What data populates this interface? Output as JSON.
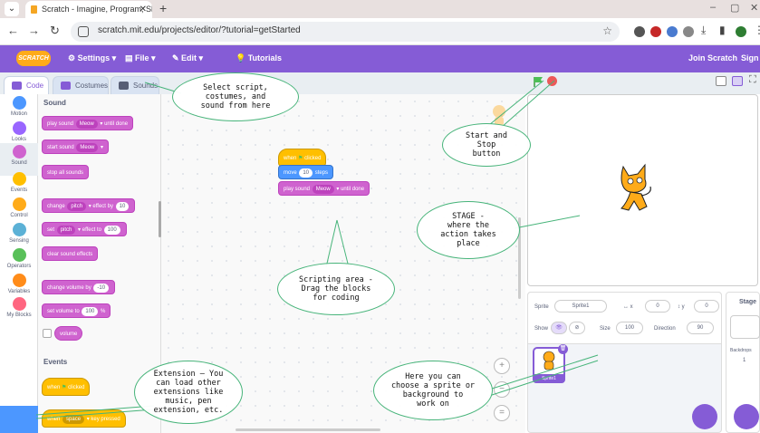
{
  "browser": {
    "tab_title": "Scratch - Imagine, Program, Sh",
    "url": "scratch.mit.edu/projects/editor/?tutorial=getStarted"
  },
  "menu": {
    "logo": "SCRATCH",
    "settings": "Settings",
    "file": "File",
    "edit": "Edit",
    "tutorials": "Tutorials",
    "join": "Join Scratch",
    "signin": "Sign in"
  },
  "tabs": {
    "code": "Code",
    "costumes": "Costumes",
    "sounds": "Sounds"
  },
  "categories": [
    {
      "label": "Motion",
      "color": "#4c97ff"
    },
    {
      "label": "Looks",
      "color": "#9966ff"
    },
    {
      "label": "Sound",
      "color": "#cf63cf"
    },
    {
      "label": "Events",
      "color": "#ffbf00"
    },
    {
      "label": "Control",
      "color": "#ffab19"
    },
    {
      "label": "Sensing",
      "color": "#5cb1d6"
    },
    {
      "label": "Operators",
      "color": "#59c059"
    },
    {
      "label": "Variables",
      "color": "#ff8c1a"
    },
    {
      "label": "My Blocks",
      "color": "#ff6680"
    }
  ],
  "palette": {
    "sound_title": "Sound",
    "play_sound": "play sound",
    "until_done": "until done",
    "meow": "Meow",
    "start_sound": "start sound",
    "stop_all_sounds": "stop all sounds",
    "change": "change",
    "pitch": "pitch",
    "effect_by": "effect by",
    "effect_by_value": "10",
    "set": "set",
    "effect_to": "effect to",
    "effect_to_value": "100",
    "clear_effects": "clear sound effects",
    "change_volume": "change volume by",
    "change_volume_value": "-10",
    "set_volume": "set volume to",
    "set_volume_value": "100",
    "percent": "%",
    "volume": "volume",
    "events_title": "Events",
    "when": "when",
    "clicked": "clicked",
    "space": "space",
    "key_pressed": "key pressed"
  },
  "script": {
    "when": "when",
    "clicked": "clicked",
    "move": "move",
    "steps_value": "10",
    "steps": "steps",
    "play_sound": "play sound",
    "meow": "Meow",
    "until_done": "until done"
  },
  "sprite_info": {
    "sprite_label": "Sprite",
    "sprite_name": "Sprite1",
    "x_label": "x",
    "x_value": "0",
    "y_label": "y",
    "y_value": "0",
    "show_label": "Show",
    "size_label": "Size",
    "size_value": "100",
    "direction_label": "Direction",
    "direction_value": "90",
    "thumb_name": "Sprite1"
  },
  "stage_col": {
    "title": "Stage",
    "backdrops_label": "Backdrops",
    "backdrops_count": "1"
  },
  "callouts": {
    "select": "Select script,\ncostumes, and\nsound from here",
    "startstop": "Start and\nStop\nbutton",
    "stage": "STAGE -\nwhere the\naction takes\nplace",
    "scripting": "Scripting area -\nDrag the blocks\nfor coding",
    "extension": "Extension – You\ncan load other\nextensions like\nmusic, pen\nextension, etc.",
    "sprite": "Here you can\nchoose a sprite or\nbackground to\nwork on"
  }
}
